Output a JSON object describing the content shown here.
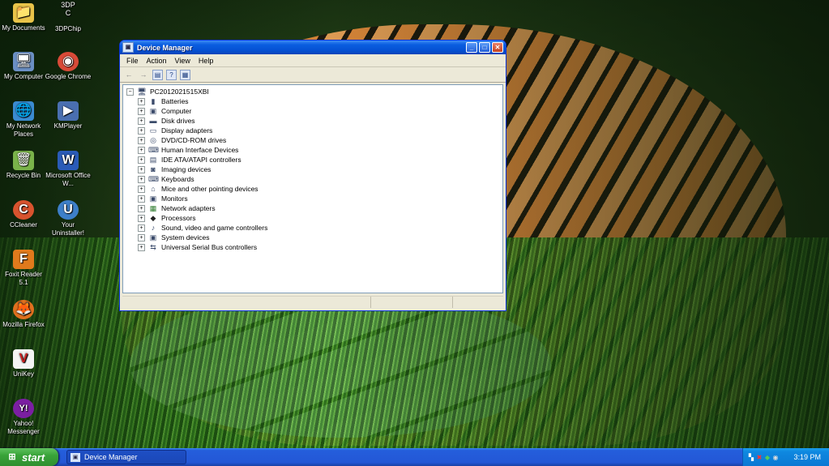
{
  "desktop": {
    "icons": [
      {
        "label": "My Documents",
        "glyph": "📁"
      },
      {
        "label": "3DP\nC",
        "glyph": ""
      },
      {
        "label": "3DPChip",
        "glyph": ""
      },
      {
        "label": "My Computer",
        "glyph": "🖥"
      },
      {
        "label": "Google Chrome",
        "glyph": "◉"
      },
      {
        "label": "My Network Places",
        "glyph": "🌐"
      },
      {
        "label": "KMPlayer",
        "glyph": "▶"
      },
      {
        "label": "Recycle Bin",
        "glyph": "🗑"
      },
      {
        "label": "Microsoft Office W...",
        "glyph": "W"
      },
      {
        "label": "CCleaner",
        "glyph": "C"
      },
      {
        "label": "Your Uninstaller!",
        "glyph": "U"
      },
      {
        "label": "Foxit Reader 5.1",
        "glyph": "F"
      },
      {
        "label": "Mozilla Firefox",
        "glyph": "🦊"
      },
      {
        "label": "UniKey",
        "glyph": "V"
      },
      {
        "label": "Yahoo! Messenger",
        "glyph": "Y!"
      }
    ]
  },
  "window": {
    "title": "Device Manager",
    "minimize": "_",
    "maximize": "□",
    "close": "✕",
    "menu": [
      "File",
      "Action",
      "View",
      "Help"
    ],
    "toolbar": {
      "back": "←",
      "forward": "→",
      "properties": "▤",
      "help": "?",
      "view": "▦"
    },
    "tree": {
      "root": "PC2012021515XBI",
      "collapse_symbol": "−",
      "expand_symbol": "+",
      "nodes": [
        "Batteries",
        "Computer",
        "Disk drives",
        "Display adapters",
        "DVD/CD-ROM drives",
        "Human Interface Devices",
        "IDE ATA/ATAPI controllers",
        "Imaging devices",
        "Keyboards",
        "Mice and other pointing devices",
        "Monitors",
        "Network adapters",
        "Processors",
        "Sound, video and game controllers",
        "System devices",
        "Universal Serial Bus controllers"
      ]
    }
  },
  "taskbar": {
    "start_label": "start",
    "task_label": "Device Manager",
    "clock": "3:19 PM"
  }
}
